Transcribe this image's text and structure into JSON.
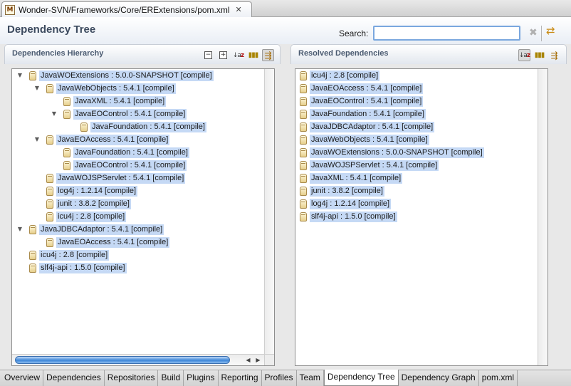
{
  "editor_tab": {
    "icon": "M",
    "title": "Wonder-SVN/Frameworks/Core/ERExtensions/pom.xml",
    "close": "✕"
  },
  "header": {
    "title": "Dependency Tree",
    "search_label": "Search:",
    "search_value": ""
  },
  "hierarchy": {
    "title": "Dependencies Hierarchy",
    "nodes": [
      {
        "label": "JavaWOExtensions : 5.0.0-SNAPSHOT [compile]",
        "level": 0,
        "expanded": true
      },
      {
        "label": "JavaWebObjects : 5.4.1 [compile]",
        "level": 1,
        "expanded": true
      },
      {
        "label": "JavaXML : 5.4.1 [compile]",
        "level": 2,
        "expanded": null
      },
      {
        "label": "JavaEOControl : 5.4.1 [compile]",
        "level": 2,
        "expanded": true
      },
      {
        "label": "JavaFoundation : 5.4.1 [compile]",
        "level": 3,
        "expanded": null
      },
      {
        "label": "JavaEOAccess : 5.4.1 [compile]",
        "level": 1,
        "expanded": true
      },
      {
        "label": "JavaFoundation : 5.4.1 [compile]",
        "level": 2,
        "expanded": null
      },
      {
        "label": "JavaEOControl : 5.4.1 [compile]",
        "level": 2,
        "expanded": null
      },
      {
        "label": "JavaWOJSPServlet : 5.4.1 [compile]",
        "level": 1,
        "expanded": null
      },
      {
        "label": "log4j : 1.2.14 [compile]",
        "level": 1,
        "expanded": null
      },
      {
        "label": "junit : 3.8.2 [compile]",
        "level": 1,
        "expanded": null
      },
      {
        "label": "icu4j : 2.8 [compile]",
        "level": 1,
        "expanded": null
      },
      {
        "label": "JavaJDBCAdaptor : 5.4.1 [compile]",
        "level": 0,
        "expanded": true
      },
      {
        "label": "JavaEOAccess : 5.4.1 [compile]",
        "level": 1,
        "expanded": null
      },
      {
        "label": "icu4j : 2.8 [compile]",
        "level": 0,
        "expanded": null
      },
      {
        "label": "slf4j-api : 1.5.0 [compile]",
        "level": 0,
        "expanded": null
      }
    ]
  },
  "resolved": {
    "title": "Resolved Dependencies",
    "items": [
      "icu4j : 2.8 [compile]",
      "JavaEOAccess : 5.4.1 [compile]",
      "JavaEOControl : 5.4.1 [compile]",
      "JavaFoundation : 5.4.1 [compile]",
      "JavaJDBCAdaptor : 5.4.1 [compile]",
      "JavaWebObjects : 5.4.1 [compile]",
      "JavaWOExtensions : 5.0.0-SNAPSHOT [compile]",
      "JavaWOJSPServlet : 5.4.1 [compile]",
      "JavaXML : 5.4.1 [compile]",
      "junit : 3.8.2 [compile]",
      "log4j : 1.2.14 [compile]",
      "slf4j-api : 1.5.0 [compile]"
    ]
  },
  "bottom_tabs": [
    "Overview",
    "Dependencies",
    "Repositories",
    "Build",
    "Plugins",
    "Reporting",
    "Profiles",
    "Team",
    "Dependency Tree",
    "Dependency Graph",
    "pom.xml"
  ],
  "active_tab": "Dependency Tree",
  "colors": {
    "selection": "#c5d9f5",
    "title": "#3c4a5e",
    "section_title": "#4a5a70",
    "scroll_thumb": "#3d86d8"
  },
  "icons": [
    "jar-icon",
    "collapse-all-icon",
    "expand-all-icon",
    "sort-icon",
    "columns-icon",
    "filter-icon",
    "clear-search-icon",
    "sync-icon"
  ]
}
